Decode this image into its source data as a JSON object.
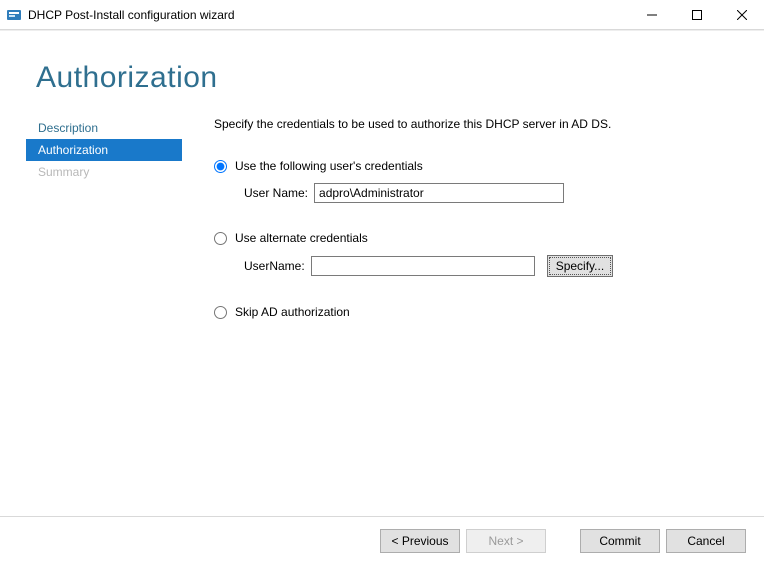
{
  "titlebar": {
    "title": "DHCP Post-Install configuration wizard"
  },
  "heading": "Authorization",
  "sidebar": {
    "items": [
      {
        "label": "Description"
      },
      {
        "label": "Authorization"
      },
      {
        "label": "Summary"
      }
    ]
  },
  "content": {
    "instruction": "Specify the credentials to be used to authorize this DHCP server in AD DS.",
    "option1": {
      "label": "Use the following user's credentials",
      "username_label": "User Name:",
      "username_value": "adpro\\Administrator"
    },
    "option2": {
      "label": "Use alternate credentials",
      "username_label": "UserName:",
      "username_value": "",
      "specify_label": "Specify..."
    },
    "option3": {
      "label": "Skip AD authorization"
    }
  },
  "footer": {
    "previous": "< Previous",
    "next": "Next >",
    "commit": "Commit",
    "cancel": "Cancel"
  }
}
